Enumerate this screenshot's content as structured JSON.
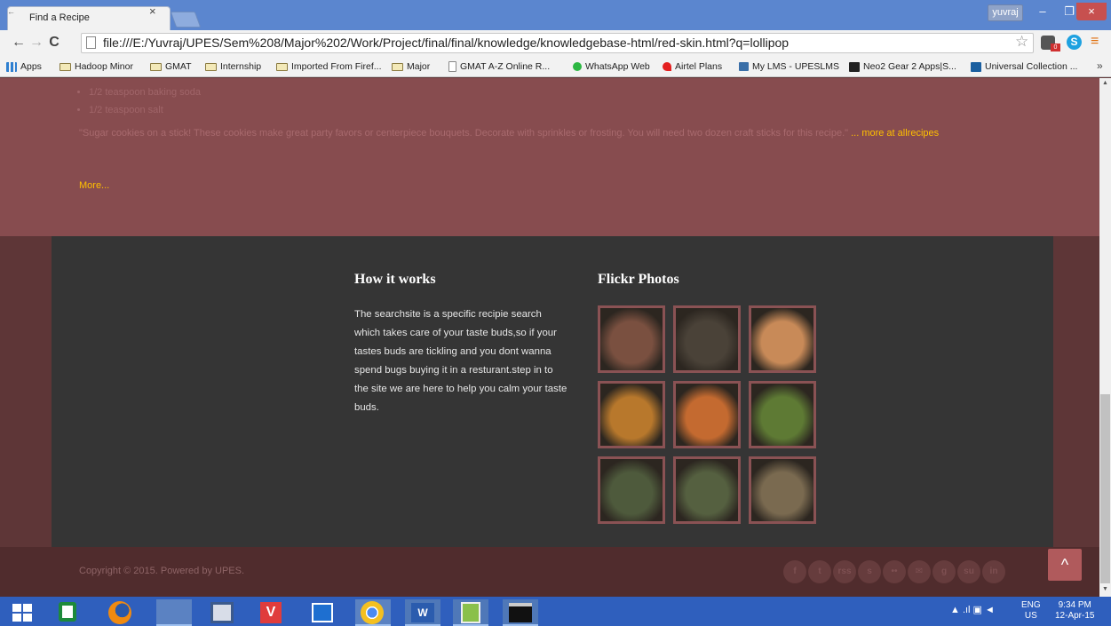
{
  "browser": {
    "tab_title": "Find a Recipe",
    "tab_icon": "←",
    "tab_close": "×",
    "user_name": "yuvraj",
    "window_controls": {
      "minimize": "–",
      "maximize": "❐",
      "close": "×"
    },
    "url": "file:///E:/Yuvraj/UPES/Sem%208/Major%202/Work/Project/final/final/knowledge/knowledgebase-html/red-skin.html?q=lollipop",
    "bookmarks": [
      {
        "label": "Apps",
        "icon": "apps-grid-icon"
      },
      {
        "label": "Hadoop Minor",
        "icon": "folder-icon"
      },
      {
        "label": "GMAT",
        "icon": "folder-icon"
      },
      {
        "label": "Internship",
        "icon": "folder-icon"
      },
      {
        "label": "Imported From Firef...",
        "icon": "folder-icon"
      },
      {
        "label": "Major",
        "icon": "folder-icon"
      },
      {
        "label": "GMAT A-Z Online R...",
        "icon": "page-icon"
      },
      {
        "label": "WhatsApp Web",
        "icon": "whatsapp-icon"
      },
      {
        "label": "Airtel Plans",
        "icon": "airtel-icon"
      },
      {
        "label": "My LMS - UPESLMS",
        "icon": "lms-icon"
      },
      {
        "label": "Neo2 Gear 2 Apps|S...",
        "icon": "neo-icon"
      },
      {
        "label": "Universal Collection ...",
        "icon": "universal-icon"
      }
    ],
    "bookmarks_more": "»",
    "ext_badge": "0"
  },
  "recipe": {
    "ingredients": [
      "1/2 teaspoon baking soda",
      "1/2 teaspoon salt"
    ],
    "description": "\"Sugar cookies on a stick! These cookies make great party favors or centerpiece bouquets. Decorate with sprinkles or frosting. You will need two dozen craft sticks for this recipe.\"",
    "more_at": "... more at allrecipes",
    "more": "More..."
  },
  "footer": {
    "how_it_works_title": "How it works",
    "how_it_works_text": "The searchsite is a specific recipie search which takes care of your taste buds,so if your tastes buds are tickling and you dont wanna spend bugs buying it in a resturant.step in to the site we are here to help you calm your taste buds.",
    "flickr_title": "Flickr Photos",
    "flickr_photos": [
      {
        "name": "salmon-dish",
        "color": "#7a5040"
      },
      {
        "name": "plated-dessert",
        "color": "#4a4238"
      },
      {
        "name": "caramel-cake",
        "color": "#c88a58"
      },
      {
        "name": "soup-bowl-nachos",
        "color": "#b8782c"
      },
      {
        "name": "fried-calamari",
        "color": "#c46a30"
      },
      {
        "name": "green-salad",
        "color": "#5e7a34"
      },
      {
        "name": "broth-bowl-bread",
        "color": "#4e5a3c"
      },
      {
        "name": "soup-with-bread",
        "color": "#556040"
      },
      {
        "name": "cream-dish",
        "color": "#7a6a50"
      }
    ],
    "copyright": "Copyright © 2015. Powered by UPES.",
    "social": [
      "f",
      "t",
      "rss",
      "s",
      "••",
      "✉",
      "g",
      "su",
      "in"
    ],
    "back_to_top": "^"
  },
  "taskbar": {
    "apps": [
      "windows-start",
      "store",
      "firefox",
      "file-explorer",
      "virtualbox",
      "vivaldi",
      "remote",
      "chrome",
      "word",
      "notepad-plus",
      "cmd"
    ],
    "tray_icons": "▲ .ıl ▣ ◄",
    "lang_top": "ENG",
    "lang_bottom": "US",
    "time": "9:34 PM",
    "date": "12-Apr-15"
  }
}
